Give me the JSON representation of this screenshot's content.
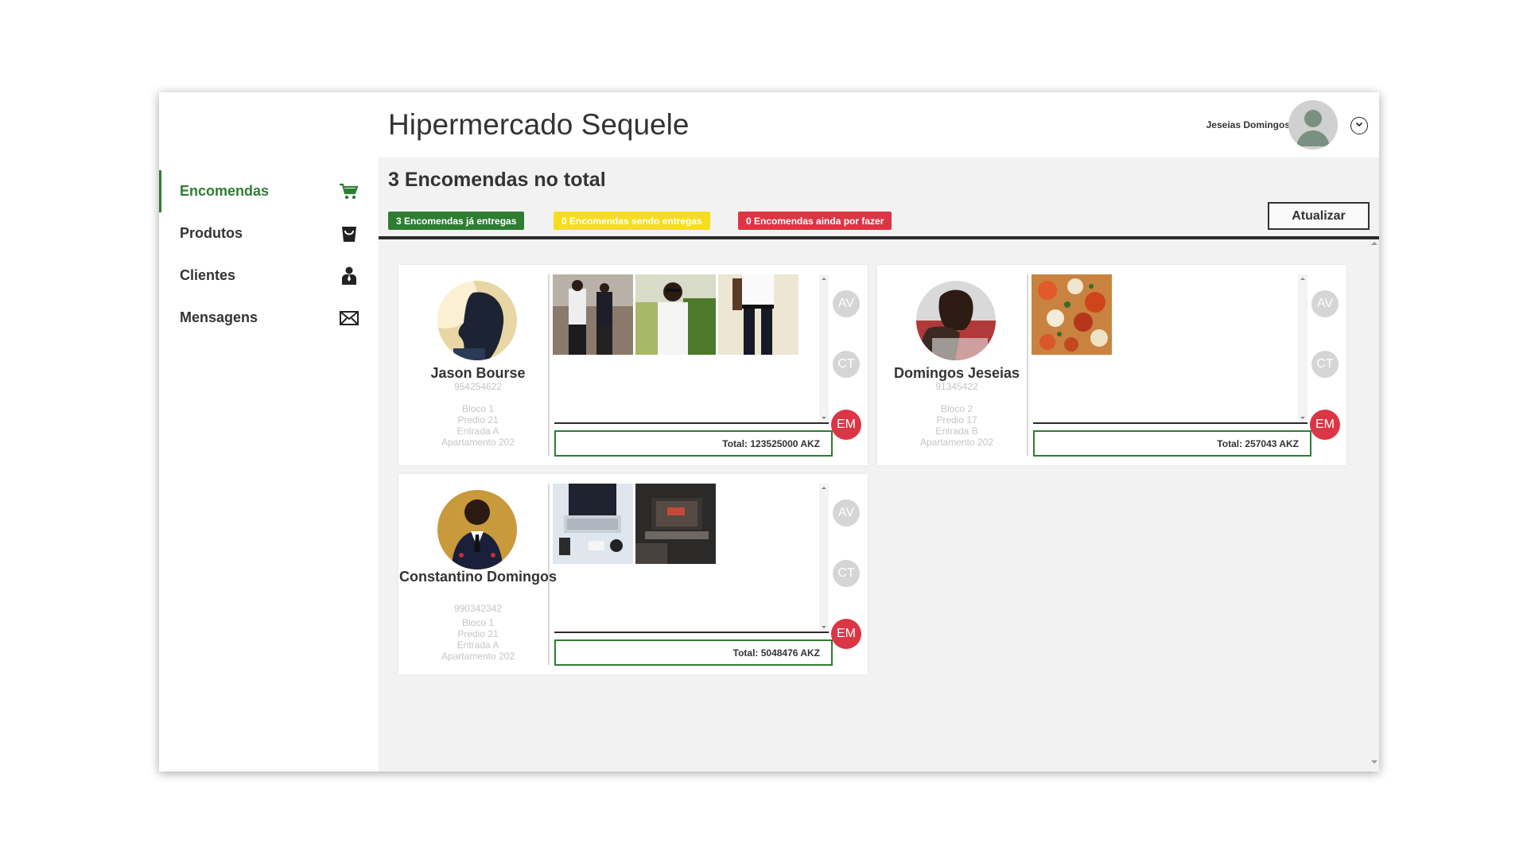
{
  "app": {
    "title": "Hipermercado Sequele"
  },
  "user": {
    "name": "Jeseias Domingos"
  },
  "sidebar": {
    "items": [
      {
        "label": "Encomendas",
        "icon": "cart-icon",
        "active": true
      },
      {
        "label": "Produtos",
        "icon": "shopping-bag-icon",
        "active": false
      },
      {
        "label": "Clientes",
        "icon": "person-icon",
        "active": false
      },
      {
        "label": "Mensagens",
        "icon": "envelope-icon",
        "active": false
      }
    ]
  },
  "main": {
    "summary": "3 Encomendas no total",
    "badges": {
      "delivered": "3 Encomendas já entregas",
      "in_delivery": "0 Encomendas sendo entregas",
      "pending": "0 Encomendas ainda por fazer"
    },
    "refresh_label": "Atualizar",
    "colors": {
      "accent": "#2e7d32",
      "warning": "#f5dd1f",
      "danger": "#dc3545"
    }
  },
  "orders": [
    {
      "customer": "Jason Bourse",
      "phone": "954254622",
      "address": [
        "Bloco 1",
        "Predio 21",
        "Entrada A",
        "Apartamento 202"
      ],
      "total": "Total: 123525000 AKZ",
      "product_count": 3,
      "status": {
        "av": "AV",
        "ct": "CT",
        "em": "EM"
      }
    },
    {
      "customer": "Domingos Jeseias",
      "phone": "91345422",
      "address": [
        "Bloco 2",
        "Predio 17",
        "Entrada B",
        "Apartamento 202"
      ],
      "total": "Total: 257043 AKZ",
      "product_count": 1,
      "status": {
        "av": "AV",
        "ct": "CT",
        "em": "EM"
      }
    },
    {
      "customer": "Constantino Domingos",
      "phone": "990342342",
      "address": [
        "Bloco 1",
        "Predio 21",
        "Entrada A",
        "Apartamento 202"
      ],
      "total": "Total: 5048476 AKZ",
      "product_count": 2,
      "status": {
        "av": "AV",
        "ct": "CT",
        "em": "EM"
      }
    }
  ]
}
